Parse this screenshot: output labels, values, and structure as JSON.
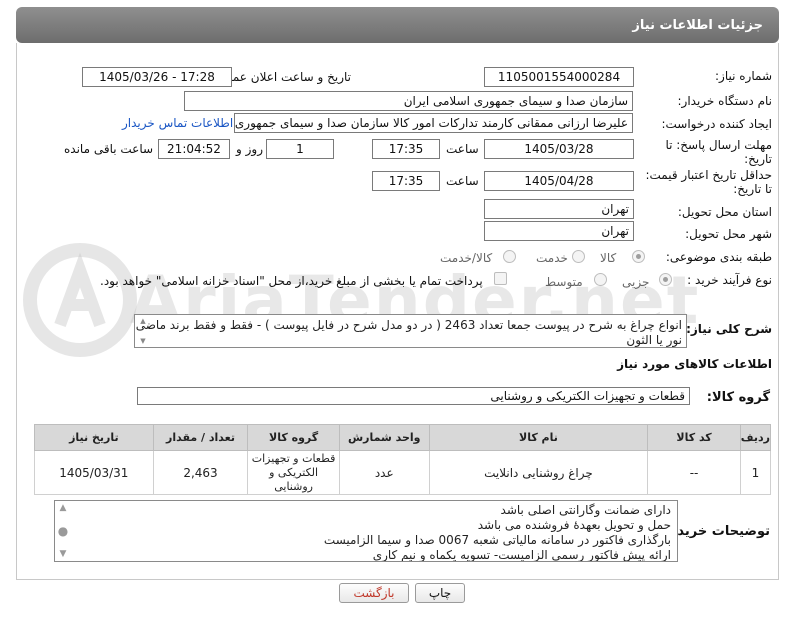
{
  "header": {
    "title": "جزئیات اطلاعات نیاز"
  },
  "fields": {
    "need_number_label": "شماره نیاز:",
    "need_number": "1105001554000284",
    "announce_label": "تاریخ و ساعت اعلان عمومی:",
    "announce_value": "1405/03/26 - 17:28",
    "buyer_org_label": "نام دستگاه خریدار:",
    "buyer_org": "سازمان صدا و سیمای جمهوری اسلامی ایران",
    "creator_label": "ایجاد کننده درخواست:",
    "creator": "علیرضا ارزانی ممقانی کارمند تدارکات امور کالا سازمان صدا و سیمای جمهوری ا",
    "contact_link": "اطلاعات تماس خریدار",
    "deadline_label_1": "مهلت ارسال پاسخ: تا",
    "deadline_label_2": "تاریخ:",
    "deadline_date": "1405/03/28",
    "time_label": "ساعت",
    "deadline_time": "17:35",
    "days_value": "1",
    "days_label": "روز و",
    "remaining_time": "21:04:52",
    "remaining_label": "ساعت باقی مانده",
    "validity_label_1": "حداقل تاریخ اعتبار قیمت:",
    "validity_label_2": "تا تاریخ:",
    "validity_date": "1405/04/28",
    "validity_time": "17:35",
    "province_label": "استان محل تحویل:",
    "province": "تهران",
    "city_label": "شهر محل تحویل:",
    "city": "تهران",
    "category_label": "طبقه بندی موضوعی:",
    "category_options": [
      "کالا",
      "خدمت",
      "کالا/خدمت"
    ],
    "process_label": "نوع فرآیند خرید :",
    "process_options": [
      "جزیی",
      "متوسط"
    ],
    "payment_note": "پرداخت تمام یا بخشی از مبلغ خرید،از محل \"اسناد خزانه اسلامی\" خواهد بود."
  },
  "description": {
    "label": "شرح کلی نیاز:",
    "line1": "انواع چراغ به شرح در پیوست جمعا تعداد 2463 ( در دو مدل شرح در فایل پیوست ) - فقط و فقط برند ماضی",
    "line2": "نور یا الثون"
  },
  "goods": {
    "section_title": "اطلاعات کالاهای مورد نیاز",
    "group_label": "گروه کالا:",
    "group_value": "قطعات و تجهیزات الکتریکی و روشنایی",
    "columns": [
      "ردیف",
      "کد کالا",
      "نام کالا",
      "واحد شمارش",
      "گروه کالا",
      "تعداد / مقدار",
      "تاریخ نیاز"
    ],
    "row": {
      "index": "1",
      "code": "--",
      "name": "چراغ روشنایی دانلایت",
      "unit": "عدد",
      "group_l1": "قطعات و تجهیزات",
      "group_l2": "الکتریکی و",
      "group_l3": "روشنایی",
      "quantity": "2,463",
      "date": "1405/03/31"
    }
  },
  "buyer_notes": {
    "label": "توضیحات خریدار:",
    "lines": [
      "دارای ضمانت وگارانتی اصلی باشد",
      "حمل و تحویل بعهدهٔ فروشنده می باشد",
      "بارگذاری فاکتور در سامانه مالیاتی شعبه 0067 صدا و سیما الزامیست",
      "ارائه پیش فاکتور رسمی الزامیست- تسویه یکماه و نیم کاری"
    ]
  },
  "buttons": {
    "print": "چاپ",
    "back": "بازگشت"
  },
  "watermark": "AriaTender.net",
  "colors": {
    "header_bg": "#7d7d7d",
    "link": "#1a56c4",
    "back_text": "#c0392b"
  }
}
